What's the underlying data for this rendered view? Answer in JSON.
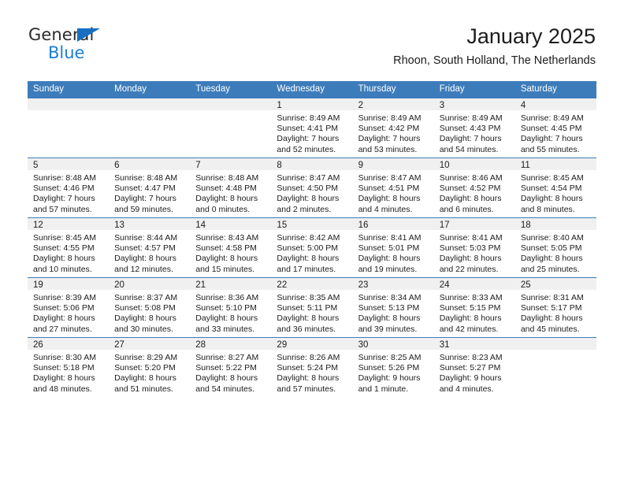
{
  "brand": {
    "line1": "General",
    "line2": "Blue",
    "triangle_color": "#176fc1",
    "line2_color": "#1b7fd4"
  },
  "header": {
    "title": "January 2025",
    "subtitle": "Rhoon, South Holland, The Netherlands"
  },
  "theme": {
    "header_blue": "#3d7cba",
    "daynum_band": "#f0f0f0",
    "text": "#1c1c1c"
  },
  "weekday_headers": [
    "Sunday",
    "Monday",
    "Tuesday",
    "Wednesday",
    "Thursday",
    "Friday",
    "Saturday"
  ],
  "weeks": [
    [
      {
        "day": "",
        "empty": true
      },
      {
        "day": "",
        "empty": true
      },
      {
        "day": "",
        "empty": true
      },
      {
        "day": "1",
        "sunrise": "Sunrise: 8:49 AM",
        "sunset": "Sunset: 4:41 PM",
        "daylight": "Daylight: 7 hours and 52 minutes."
      },
      {
        "day": "2",
        "sunrise": "Sunrise: 8:49 AM",
        "sunset": "Sunset: 4:42 PM",
        "daylight": "Daylight: 7 hours and 53 minutes."
      },
      {
        "day": "3",
        "sunrise": "Sunrise: 8:49 AM",
        "sunset": "Sunset: 4:43 PM",
        "daylight": "Daylight: 7 hours and 54 minutes."
      },
      {
        "day": "4",
        "sunrise": "Sunrise: 8:49 AM",
        "sunset": "Sunset: 4:45 PM",
        "daylight": "Daylight: 7 hours and 55 minutes."
      }
    ],
    [
      {
        "day": "5",
        "sunrise": "Sunrise: 8:48 AM",
        "sunset": "Sunset: 4:46 PM",
        "daylight": "Daylight: 7 hours and 57 minutes."
      },
      {
        "day": "6",
        "sunrise": "Sunrise: 8:48 AM",
        "sunset": "Sunset: 4:47 PM",
        "daylight": "Daylight: 7 hours and 59 minutes."
      },
      {
        "day": "7",
        "sunrise": "Sunrise: 8:48 AM",
        "sunset": "Sunset: 4:48 PM",
        "daylight": "Daylight: 8 hours and 0 minutes."
      },
      {
        "day": "8",
        "sunrise": "Sunrise: 8:47 AM",
        "sunset": "Sunset: 4:50 PM",
        "daylight": "Daylight: 8 hours and 2 minutes."
      },
      {
        "day": "9",
        "sunrise": "Sunrise: 8:47 AM",
        "sunset": "Sunset: 4:51 PM",
        "daylight": "Daylight: 8 hours and 4 minutes."
      },
      {
        "day": "10",
        "sunrise": "Sunrise: 8:46 AM",
        "sunset": "Sunset: 4:52 PM",
        "daylight": "Daylight: 8 hours and 6 minutes."
      },
      {
        "day": "11",
        "sunrise": "Sunrise: 8:45 AM",
        "sunset": "Sunset: 4:54 PM",
        "daylight": "Daylight: 8 hours and 8 minutes."
      }
    ],
    [
      {
        "day": "12",
        "sunrise": "Sunrise: 8:45 AM",
        "sunset": "Sunset: 4:55 PM",
        "daylight": "Daylight: 8 hours and 10 minutes."
      },
      {
        "day": "13",
        "sunrise": "Sunrise: 8:44 AM",
        "sunset": "Sunset: 4:57 PM",
        "daylight": "Daylight: 8 hours and 12 minutes."
      },
      {
        "day": "14",
        "sunrise": "Sunrise: 8:43 AM",
        "sunset": "Sunset: 4:58 PM",
        "daylight": "Daylight: 8 hours and 15 minutes."
      },
      {
        "day": "15",
        "sunrise": "Sunrise: 8:42 AM",
        "sunset": "Sunset: 5:00 PM",
        "daylight": "Daylight: 8 hours and 17 minutes."
      },
      {
        "day": "16",
        "sunrise": "Sunrise: 8:41 AM",
        "sunset": "Sunset: 5:01 PM",
        "daylight": "Daylight: 8 hours and 19 minutes."
      },
      {
        "day": "17",
        "sunrise": "Sunrise: 8:41 AM",
        "sunset": "Sunset: 5:03 PM",
        "daylight": "Daylight: 8 hours and 22 minutes."
      },
      {
        "day": "18",
        "sunrise": "Sunrise: 8:40 AM",
        "sunset": "Sunset: 5:05 PM",
        "daylight": "Daylight: 8 hours and 25 minutes."
      }
    ],
    [
      {
        "day": "19",
        "sunrise": "Sunrise: 8:39 AM",
        "sunset": "Sunset: 5:06 PM",
        "daylight": "Daylight: 8 hours and 27 minutes."
      },
      {
        "day": "20",
        "sunrise": "Sunrise: 8:37 AM",
        "sunset": "Sunset: 5:08 PM",
        "daylight": "Daylight: 8 hours and 30 minutes."
      },
      {
        "day": "21",
        "sunrise": "Sunrise: 8:36 AM",
        "sunset": "Sunset: 5:10 PM",
        "daylight": "Daylight: 8 hours and 33 minutes."
      },
      {
        "day": "22",
        "sunrise": "Sunrise: 8:35 AM",
        "sunset": "Sunset: 5:11 PM",
        "daylight": "Daylight: 8 hours and 36 minutes."
      },
      {
        "day": "23",
        "sunrise": "Sunrise: 8:34 AM",
        "sunset": "Sunset: 5:13 PM",
        "daylight": "Daylight: 8 hours and 39 minutes."
      },
      {
        "day": "24",
        "sunrise": "Sunrise: 8:33 AM",
        "sunset": "Sunset: 5:15 PM",
        "daylight": "Daylight: 8 hours and 42 minutes."
      },
      {
        "day": "25",
        "sunrise": "Sunrise: 8:31 AM",
        "sunset": "Sunset: 5:17 PM",
        "daylight": "Daylight: 8 hours and 45 minutes."
      }
    ],
    [
      {
        "day": "26",
        "sunrise": "Sunrise: 8:30 AM",
        "sunset": "Sunset: 5:18 PM",
        "daylight": "Daylight: 8 hours and 48 minutes."
      },
      {
        "day": "27",
        "sunrise": "Sunrise: 8:29 AM",
        "sunset": "Sunset: 5:20 PM",
        "daylight": "Daylight: 8 hours and 51 minutes."
      },
      {
        "day": "28",
        "sunrise": "Sunrise: 8:27 AM",
        "sunset": "Sunset: 5:22 PM",
        "daylight": "Daylight: 8 hours and 54 minutes."
      },
      {
        "day": "29",
        "sunrise": "Sunrise: 8:26 AM",
        "sunset": "Sunset: 5:24 PM",
        "daylight": "Daylight: 8 hours and 57 minutes."
      },
      {
        "day": "30",
        "sunrise": "Sunrise: 8:25 AM",
        "sunset": "Sunset: 5:26 PM",
        "daylight": "Daylight: 9 hours and 1 minute."
      },
      {
        "day": "31",
        "sunrise": "Sunrise: 8:23 AM",
        "sunset": "Sunset: 5:27 PM",
        "daylight": "Daylight: 9 hours and 4 minutes."
      },
      {
        "day": "",
        "empty": true
      }
    ]
  ]
}
